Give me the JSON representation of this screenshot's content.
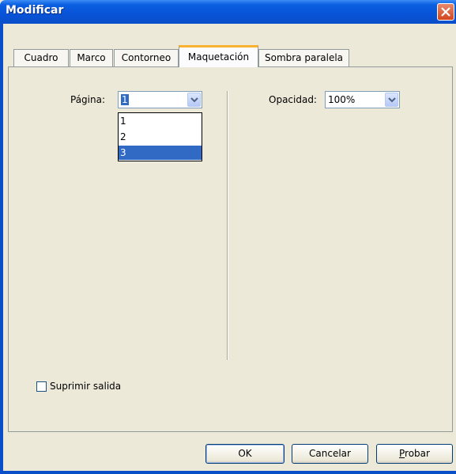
{
  "window": {
    "title": "Modificar"
  },
  "tabs": [
    {
      "label": "Cuadro"
    },
    {
      "label": "Marco"
    },
    {
      "label": "Contorneo"
    },
    {
      "label": "Maquetación",
      "active": true
    },
    {
      "label": "Sombra paralela"
    }
  ],
  "pagina": {
    "label": "Página:",
    "value": "1",
    "options": [
      "1",
      "2",
      "3"
    ],
    "highlighted_option": "3"
  },
  "opacidad": {
    "label": "Opacidad:",
    "value": "100%"
  },
  "suppress": {
    "label": "Suprimir salida",
    "checked": false
  },
  "buttons": {
    "ok": "OK",
    "cancel": "Cancelar",
    "try_first": "P",
    "try_rest": "robar"
  },
  "colors": {
    "titlebar": "#0a4ec8",
    "dialog_bg": "#ece9d8",
    "selection": "#316ac5",
    "active_tab_accent": "#f9b130"
  }
}
